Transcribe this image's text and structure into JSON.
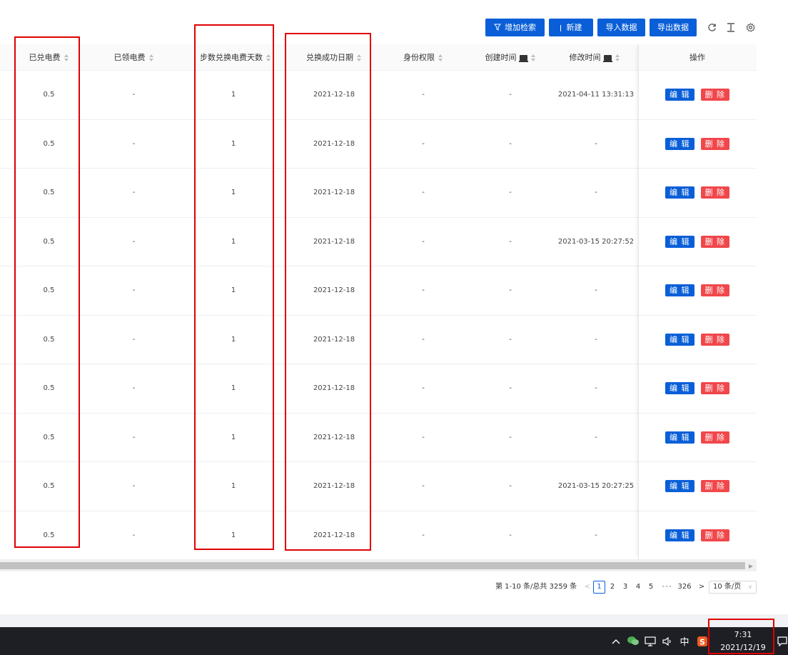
{
  "toolbar": {
    "advanced_search_label": "增加检索",
    "new_label": "新建",
    "import_label": "导入数据",
    "export_label": "导出数据",
    "refresh_icon": "refresh-icon",
    "density_icon": "column-height-icon",
    "settings_icon": "gear-icon"
  },
  "table": {
    "headers": [
      "已兑电费",
      "已领电费",
      "步数兑换电费天数",
      "兑换成功日期",
      "身份权限",
      "创建时间",
      "修改时间",
      "操作"
    ],
    "rows": [
      {
        "paid": "0.5",
        "received": "-",
        "days": "1",
        "date": "2021-12-18",
        "role": "-",
        "created": "-",
        "modified": "2021-04-11 13:31:13"
      },
      {
        "paid": "0.5",
        "received": "-",
        "days": "1",
        "date": "2021-12-18",
        "role": "-",
        "created": "-",
        "modified": "-"
      },
      {
        "paid": "0.5",
        "received": "-",
        "days": "1",
        "date": "2021-12-18",
        "role": "-",
        "created": "-",
        "modified": "-"
      },
      {
        "paid": "0.5",
        "received": "-",
        "days": "1",
        "date": "2021-12-18",
        "role": "-",
        "created": "-",
        "modified": "2021-03-15 20:27:52"
      },
      {
        "paid": "0.5",
        "received": "-",
        "days": "1",
        "date": "2021-12-18",
        "role": "-",
        "created": "-",
        "modified": "-"
      },
      {
        "paid": "0.5",
        "received": "-",
        "days": "1",
        "date": "2021-12-18",
        "role": "-",
        "created": "-",
        "modified": "-"
      },
      {
        "paid": "0.5",
        "received": "-",
        "days": "1",
        "date": "2021-12-18",
        "role": "-",
        "created": "-",
        "modified": "-"
      },
      {
        "paid": "0.5",
        "received": "-",
        "days": "1",
        "date": "2021-12-18",
        "role": "-",
        "created": "-",
        "modified": "-"
      },
      {
        "paid": "0.5",
        "received": "-",
        "days": "1",
        "date": "2021-12-18",
        "role": "-",
        "created": "-",
        "modified": "2021-03-15 20:27:25"
      },
      {
        "paid": "0.5",
        "received": "-",
        "days": "1",
        "date": "2021-12-18",
        "role": "-",
        "created": "-",
        "modified": "-"
      }
    ],
    "edit_label": "编 辑",
    "delete_label": "删 除"
  },
  "pagination": {
    "summary": "第 1-10 条/总共 3259 条",
    "pages": [
      "1",
      "2",
      "3",
      "4",
      "5"
    ],
    "ellipsis": "•••",
    "last_page": "326",
    "page_size": "10 条/页"
  },
  "taskbar": {
    "ime": "中",
    "time": "7:31",
    "date": "2021/12/19"
  },
  "colors": {
    "primary": "#0a5fd8",
    "danger": "#f0474b",
    "highlight": "#e00000"
  }
}
